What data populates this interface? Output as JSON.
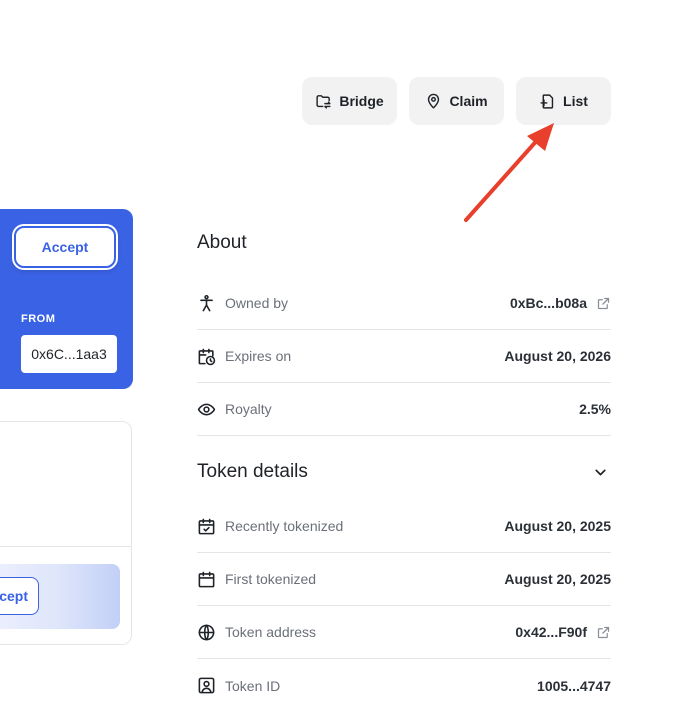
{
  "actions": {
    "bridge_label": "Bridge",
    "claim_label": "Claim",
    "list_label": "List"
  },
  "offer_card": {
    "accept_label": "Accept",
    "from_label": "FROM",
    "from_address": "0x6C...1aa3"
  },
  "pending_card": {
    "accept_label": "Accept"
  },
  "about": {
    "title": "About",
    "rows": [
      {
        "label": "Owned by",
        "value": "0xBc...b08a",
        "icon": "person-icon",
        "external_link": true
      },
      {
        "label": "Expires on",
        "value": "August 20, 2026",
        "icon": "calendar-clock-icon"
      },
      {
        "label": "Royalty",
        "value": "2.5%",
        "icon": "eye-icon"
      }
    ]
  },
  "token_details": {
    "title": "Token details",
    "rows": [
      {
        "label": "Recently tokenized",
        "value": "August 20, 2025",
        "icon": "calendar-check-icon"
      },
      {
        "label": "First tokenized",
        "value": "August 20, 2025",
        "icon": "calendar-icon"
      },
      {
        "label": "Token address",
        "value": "0x42...F90f",
        "icon": "globe-icon",
        "external_link": true
      },
      {
        "label": "Token ID",
        "value": "1005...4747",
        "icon": "id-card-icon"
      }
    ]
  },
  "colors": {
    "accent": "#3a62e4",
    "button_bg": "#f2f2f3",
    "annotation_arrow": "#e8402c"
  }
}
